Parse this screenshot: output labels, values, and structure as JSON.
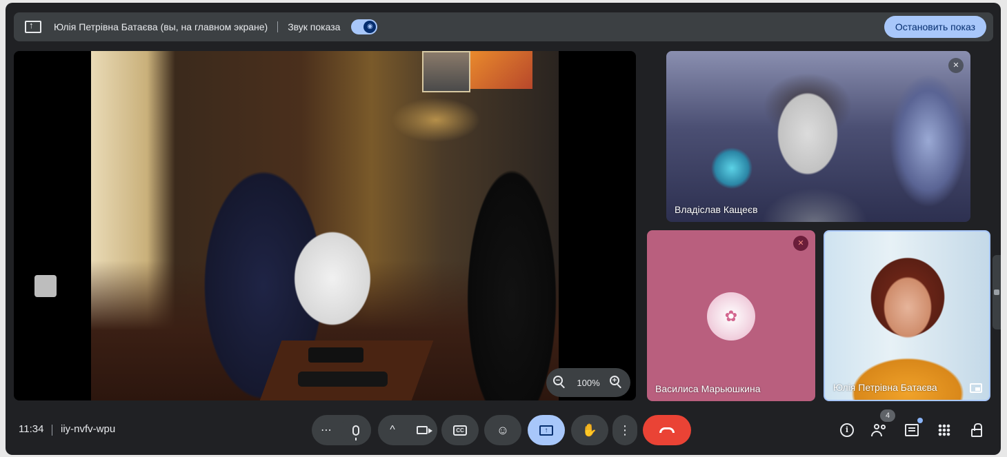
{
  "presenting_bar": {
    "presenter_text": "Юлія Петрівна Батаєва (вы, на главном экране)",
    "sound_label": "Звук показа",
    "stop_button": "Остановить показ"
  },
  "stage": {
    "zoom_level": "100%"
  },
  "participants": [
    {
      "name": "Владіслав Кащеєв",
      "muted": true
    },
    {
      "name": "Василиса Марьюшкина",
      "muted": true
    },
    {
      "name": "Юлія Петрівна Батаєва",
      "muted": false
    }
  ],
  "bottom_bar": {
    "time": "11:34",
    "meeting_code": "iiy-nvfv-wpu",
    "people_count": "4"
  },
  "icons": {
    "more": "⋯",
    "chevron_up": "^",
    "emoji": "☺",
    "raise_hand": "✋",
    "more_vert": "⋮"
  },
  "colors": {
    "accent": "#a8c7fa",
    "end_call": "#ea4335",
    "background": "#202124",
    "control": "#3c4043"
  }
}
